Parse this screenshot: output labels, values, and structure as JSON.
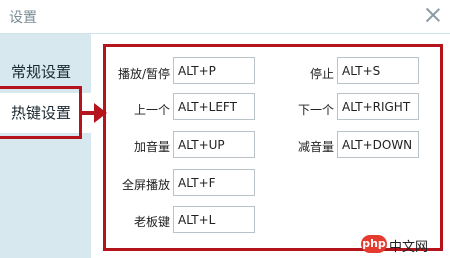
{
  "window": {
    "title": "设置"
  },
  "sidebar": {
    "items": [
      {
        "label": "常规设置"
      },
      {
        "label": "热键设置"
      }
    ]
  },
  "hotkeys": {
    "play_pause": {
      "label": "播放/暂停",
      "value": "ALT+P"
    },
    "stop": {
      "label": "停止",
      "value": "ALT+S"
    },
    "previous": {
      "label": "上一个",
      "value": "ALT+LEFT"
    },
    "next": {
      "label": "下一个",
      "value": "ALT+RIGHT"
    },
    "volume_up": {
      "label": "加音量",
      "value": "ALT+UP"
    },
    "volume_down": {
      "label": "减音量",
      "value": "ALT+DOWN"
    },
    "fullscreen": {
      "label": "全屏播放",
      "value": "ALT+F"
    },
    "boss_key": {
      "label": "老板键",
      "value": "ALT+L"
    }
  },
  "watermark": {
    "logo_text": "php",
    "text": "中文网"
  },
  "colors": {
    "highlight": "#b5141c",
    "sidebar_bg": "#d7e9ef"
  }
}
